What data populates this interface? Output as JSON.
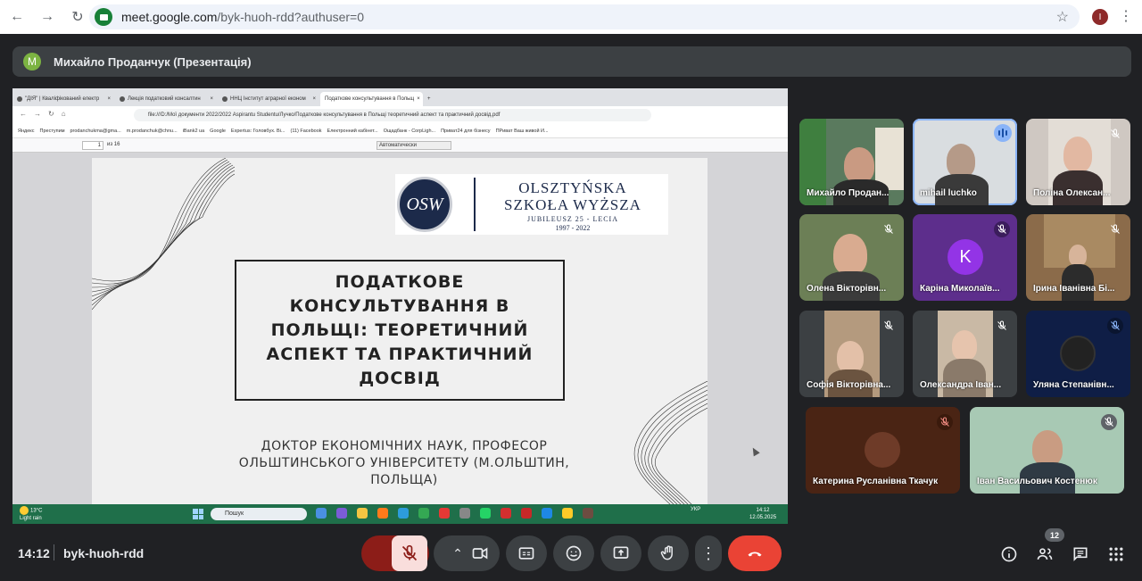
{
  "browser": {
    "url_host": "meet.google.com",
    "url_path": "/byk-huoh-rdd?authuser=0",
    "profile_initial": "I"
  },
  "presenter": {
    "avatar_initial": "M",
    "name": "Михайло Проданчук (Презентація)"
  },
  "shared_screen": {
    "tabs": [
      "\"ДІЯ\" | Кваліфікований електр",
      "Лекція податковий консалтин",
      "ННЦ Інститут аграрної економ",
      "Податкове консультування в Польщ"
    ],
    "address": "file:///D:/Мої документи 2022/2022 Aspirantu Studentu/Лучко/Податкове консультування в Польщі теоретичний аспект та практичний досвід.pdf",
    "bookmarks": [
      "Яндекс",
      "Преступим",
      "prodanchukma@gma...",
      "m.prodanchuk@chnu...",
      "iBank2 ua",
      "Google",
      "Expertus: Головбух. Ві...",
      "(11) Facebook",
      "Електронний кабінет...",
      "Ощадбанк - CorpLigh...",
      "Приват24 для бізнесу",
      "ПРиват Ваш живой И..."
    ],
    "pdf_page": "1",
    "pdf_of": "из 16",
    "zoom": "Автоматически",
    "slide": {
      "logo_line1": "OLSZTYŃSKA",
      "logo_line2": "SZKOŁA WYŻSZA",
      "logo_line3": "JUBILEUSZ 25 - LECIA",
      "logo_line4": "1997 - 2022",
      "logo_mark": "OSW",
      "title": "ПОДАТКОВЕ КОНСУЛЬТУВАННЯ В ПОЛЬЩІ: ТЕОРЕТИЧНИЙ АСПЕКТ ТА ПРАКТИЧНИЙ ДОСВІД",
      "author": "ДОКТОР ЕКОНОМІЧНИХ НАУК, ПРОФЕСОР ОЛЬШТИНСЬКОГО УНІВЕРСИТЕТУ (М.ОЛЬШТИН, ПОЛЬЩА)"
    },
    "taskbar": {
      "temp": "13°C",
      "weather": "Light rain",
      "search": "Пошук",
      "lang": "УКР",
      "time": "14:12",
      "date": "12.05.2025"
    }
  },
  "participants": [
    {
      "name": "Михайло Продан...",
      "muted": false,
      "speaking": false
    },
    {
      "name": "mihail luchko",
      "muted": false,
      "speaking": true
    },
    {
      "name": "Поліна Олексан...",
      "muted": true
    },
    {
      "name": "Олена Вікторівн...",
      "muted": true
    },
    {
      "name": "Каріна Миколаїв...",
      "muted": true,
      "initial": "K"
    },
    {
      "name": "Ірина Іванівна Бі...",
      "muted": true
    },
    {
      "name": "Софія Вікторівна...",
      "muted": true
    },
    {
      "name": "Олександра Іван...",
      "muted": true
    },
    {
      "name": "Уляна Степанівн...",
      "muted": true
    },
    {
      "name": "Катерина Русланівна Ткачук",
      "muted": true
    },
    {
      "name": "Іван Васильович Костенюк",
      "muted": true
    }
  ],
  "meeting": {
    "time": "14:12",
    "code": "byk-huoh-rdd",
    "participant_count": "12"
  },
  "colors": {
    "end_call": "#ea4335",
    "mic_muted_bg": "#f9dedc",
    "speaking": "#8ab4f8"
  }
}
